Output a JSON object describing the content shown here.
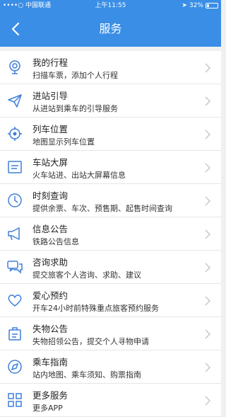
{
  "status_bar": {
    "carrier": "••••○ 中国联通",
    "time": "上午11:55",
    "battery": "32%",
    "battery_level_percent": 32
  },
  "navbar": {
    "title": "服务",
    "back_icon": "chevron-left-icon"
  },
  "colors": {
    "header": "#3a8ee6",
    "icon": "#3f7fd8"
  },
  "services": [
    {
      "name": "我的行程",
      "desc": "扫描车票，添加个人行程",
      "icon": "location-pin-icon"
    },
    {
      "name": "进站引导",
      "desc": "从进站到乘车的引导服务",
      "icon": "paper-plane-icon"
    },
    {
      "name": "列车位置",
      "desc": "地图显示列车位置",
      "icon": "crosshair-icon"
    },
    {
      "name": "车站大屏",
      "desc": "火车站进、出站大屏幕信息",
      "icon": "display-screen-icon"
    },
    {
      "name": "时刻查询",
      "desc": "提供余票、车次、预售期、起售时间查询",
      "icon": "clock-icon"
    },
    {
      "name": "信息公告",
      "desc": "铁路公告信息",
      "icon": "megaphone-icon"
    },
    {
      "name": "咨询求助",
      "desc": "提交旅客个人咨询、求助、建议",
      "icon": "chat-bubbles-icon"
    },
    {
      "name": "爱心预约",
      "desc": "开车24小时前特殊重点旅客预约服务",
      "icon": "heart-icon"
    },
    {
      "name": "失物公告",
      "desc": "失物招领公告，提交个人寻物申请",
      "icon": "lost-found-icon"
    },
    {
      "name": "乘车指南",
      "desc": "站内地图、乘车须知、购票指南",
      "icon": "compass-icon"
    },
    {
      "name": "更多服务",
      "desc": "更多APP",
      "icon": "more-grid-icon"
    }
  ]
}
